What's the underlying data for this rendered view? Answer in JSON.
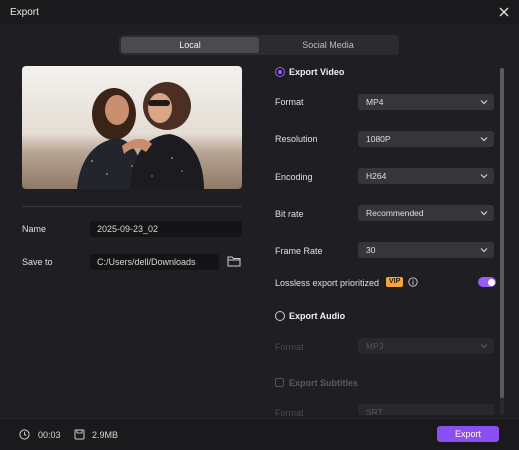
{
  "window": {
    "title": "Export"
  },
  "tabs": [
    {
      "label": "Local"
    },
    {
      "label": "Social Media"
    }
  ],
  "file": {
    "name_label": "Name",
    "name_value": "2025-09-23_02",
    "save_label": "Save to",
    "save_value": "C:/Users/dell/Downloads"
  },
  "video": {
    "heading": "Export Video",
    "rows": [
      {
        "label": "Format",
        "value": "MP4"
      },
      {
        "label": "Resolution",
        "value": "1080P"
      },
      {
        "label": "Encoding",
        "value": "H264"
      },
      {
        "label": "Bit rate",
        "value": "Recommended"
      },
      {
        "label": "Frame Rate",
        "value": "30"
      }
    ],
    "lossless_label": "Lossless export prioritized",
    "vip_badge": "VIP",
    "lossless_enabled": true
  },
  "audio": {
    "heading": "Export Audio",
    "format_label": "Format",
    "format_value": "MP3"
  },
  "subtitles": {
    "heading": "Export Subtitles",
    "format_label": "Format",
    "format_value": "SRT"
  },
  "footer": {
    "duration": "00:03",
    "size": "2.9MB",
    "export_label": "Export"
  },
  "colors": {
    "accent": "#8b4ef0",
    "vip": "#f4a340",
    "background": "#1f1f23"
  }
}
